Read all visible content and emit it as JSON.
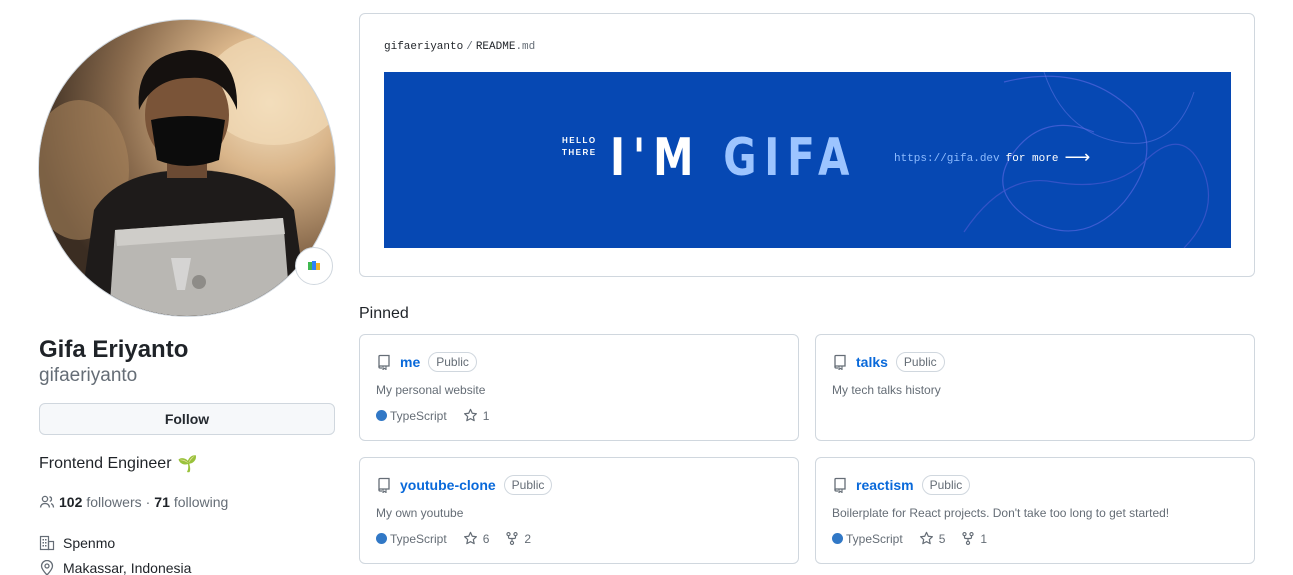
{
  "profile": {
    "name": "Gifa Eriyanto",
    "login": "gifaeriyanto",
    "follow_label": "Follow",
    "bio": "Frontend Engineer",
    "bio_emoji": "🌱",
    "followers_count": "102",
    "followers_label": "followers",
    "separator": "·",
    "following_count": "71",
    "following_label": "following",
    "company": "Spenmo",
    "location": "Makassar, Indonesia",
    "status_icon": "status-emoji-icon"
  },
  "readme": {
    "owner": "gifaeriyanto",
    "separator": "/",
    "file_base": "README",
    "file_ext": ".md",
    "banner": {
      "hello_line1": "HELLO",
      "hello_line2": "THERE",
      "title_part1": "I'M ",
      "title_part2": "GIFA",
      "url": "https://gifa.dev",
      "for_more": "for more",
      "arrow": "⟶"
    }
  },
  "pinned": {
    "title": "Pinned",
    "repos": [
      {
        "name": "me",
        "visibility": "Public",
        "description": "My personal website",
        "language": "TypeScript",
        "stars": "1",
        "forks": ""
      },
      {
        "name": "talks",
        "visibility": "Public",
        "description": "My tech talks history",
        "language": "",
        "stars": "",
        "forks": ""
      },
      {
        "name": "youtube-clone",
        "visibility": "Public",
        "description": "My own youtube",
        "language": "TypeScript",
        "stars": "6",
        "forks": "2"
      },
      {
        "name": "reactism",
        "visibility": "Public",
        "description": "Boilerplate for React projects. Don't take too long to get started!",
        "language": "TypeScript",
        "stars": "5",
        "forks": "1"
      }
    ]
  },
  "colors": {
    "link": "#0969da",
    "banner_bg": "#0648b3",
    "typescript": "#3178c6",
    "muted": "#656d76"
  }
}
